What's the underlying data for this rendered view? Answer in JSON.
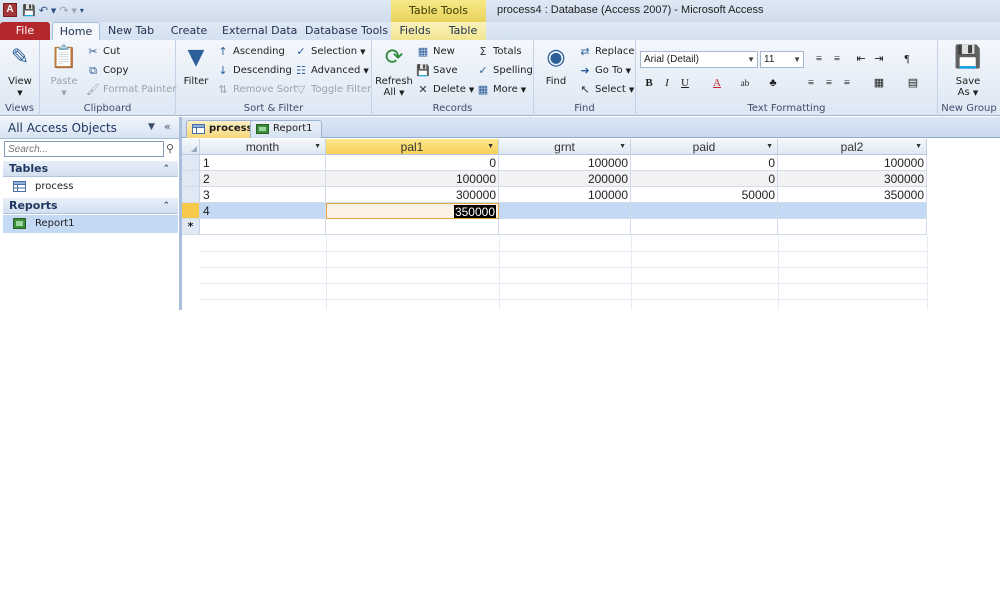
{
  "window": {
    "title": "process4 : Database (Access 2007)  -  Microsoft Access",
    "app_icon_letter": "A",
    "context_tab_group": "Table Tools"
  },
  "tabs": {
    "file": "File",
    "home": "Home",
    "new_tab": "New Tab",
    "create": "Create",
    "external_data": "External Data",
    "database_tools": "Database Tools",
    "fields": "Fields",
    "table": "Table"
  },
  "ribbon": {
    "views": {
      "label": "Views",
      "view": "View"
    },
    "clipboard": {
      "label": "Clipboard",
      "paste": "Paste",
      "cut": "Cut",
      "copy": "Copy",
      "format_painter": "Format Painter"
    },
    "sort_filter": {
      "label": "Sort & Filter",
      "filter": "Filter",
      "ascending": "Ascending",
      "descending": "Descending",
      "remove_sort": "Remove Sort",
      "selection": "Selection",
      "advanced": "Advanced",
      "toggle_filter": "Toggle Filter"
    },
    "records": {
      "label": "Records",
      "refresh": "Refresh",
      "refresh_sub": "All",
      "new": "New",
      "save": "Save",
      "delete": "Delete",
      "totals": "Totals",
      "spelling": "Spelling",
      "more": "More"
    },
    "find": {
      "label": "Find",
      "find": "Find",
      "replace": "Replace",
      "goto": "Go To",
      "select": "Select"
    },
    "text_formatting": {
      "label": "Text Formatting",
      "font": "Arial (Detail)",
      "size": "11",
      "bold": "B",
      "italic": "I",
      "underline": "U"
    },
    "new_group": {
      "label": "New Group",
      "save_as": "Save",
      "save_as_sub": "As"
    }
  },
  "nav": {
    "header": "All Access Objects",
    "search_placeholder": "Search...",
    "sections": [
      {
        "title": "Tables",
        "items": [
          "process"
        ]
      },
      {
        "title": "Reports",
        "items": [
          "Report1"
        ]
      }
    ]
  },
  "documents": {
    "tabs": [
      "process",
      "Report1"
    ]
  },
  "datasheet": {
    "columns": [
      "month",
      "pal1",
      "grnt",
      "paid",
      "pal2"
    ],
    "rows": [
      [
        "1",
        "0",
        "100000",
        "0",
        "100000"
      ],
      [
        "2",
        "100000",
        "200000",
        "0",
        "300000"
      ],
      [
        "3",
        "300000",
        "100000",
        "50000",
        "350000"
      ],
      [
        "4",
        "350000",
        "",
        "",
        ""
      ]
    ],
    "new_row_marker": "*"
  },
  "colors": {
    "file_tab": "#b4272a",
    "context_tab": "#f0dd6a",
    "selected_row": "#c4d9f3",
    "active_cell_border": "#e6a34a"
  }
}
